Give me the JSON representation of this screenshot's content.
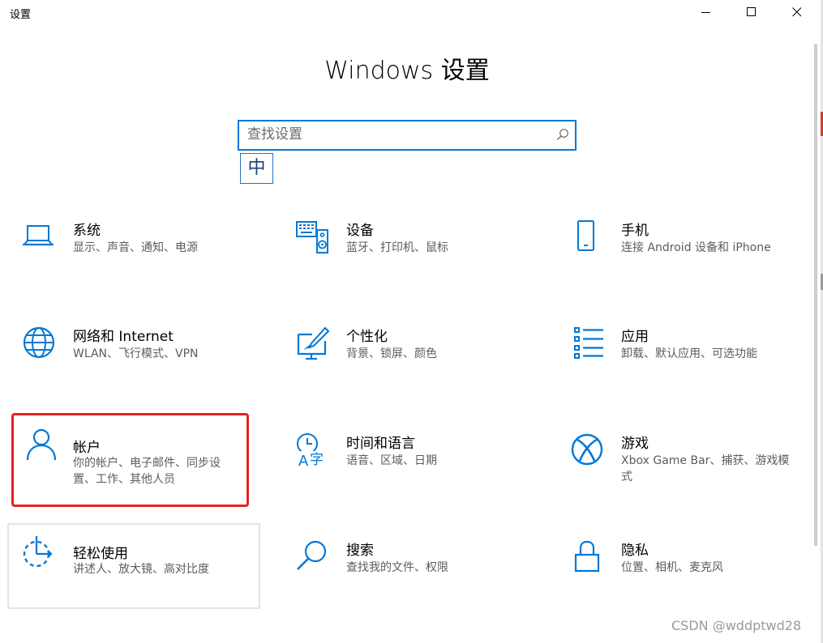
{
  "window": {
    "title": "设置"
  },
  "header": {
    "title": "Windows 设置"
  },
  "search": {
    "placeholder": "查找设置",
    "value": ""
  },
  "ime": {
    "label": "中"
  },
  "tiles": [
    {
      "title": "系统",
      "desc": "显示、声音、通知、电源",
      "icon": "laptop-icon"
    },
    {
      "title": "设备",
      "desc": "蓝牙、打印机、鼠标",
      "icon": "devices-icon"
    },
    {
      "title": "手机",
      "desc": "连接 Android 设备和 iPhone",
      "icon": "phone-icon"
    },
    {
      "title": "网络和 Internet",
      "desc": "WLAN、飞行模式、VPN",
      "icon": "globe-icon"
    },
    {
      "title": "个性化",
      "desc": "背景、锁屏、颜色",
      "icon": "personalization-icon"
    },
    {
      "title": "应用",
      "desc": "卸载、默认应用、可选功能",
      "icon": "apps-list-icon"
    },
    {
      "title": "帐户",
      "desc": "你的帐户、电子邮件、同步设置、工作、其他人员",
      "icon": "user-icon"
    },
    {
      "title": "时间和语言",
      "desc": "语音、区域、日期",
      "icon": "time-language-icon"
    },
    {
      "title": "游戏",
      "desc": "Xbox Game Bar、捕获、游戏模式",
      "icon": "xbox-icon"
    },
    {
      "title": "轻松使用",
      "desc": "讲述人、放大镜、高对比度",
      "icon": "ease-of-access-icon"
    },
    {
      "title": "搜索",
      "desc": "查找我的文件、权限",
      "icon": "search-tile-icon"
    },
    {
      "title": "隐私",
      "desc": "位置、相机、麦克风",
      "icon": "lock-icon"
    }
  ],
  "colors": {
    "accent": "#0078d7",
    "highlight": "#e5211e"
  },
  "watermark": "CSDN @wddptwd28"
}
